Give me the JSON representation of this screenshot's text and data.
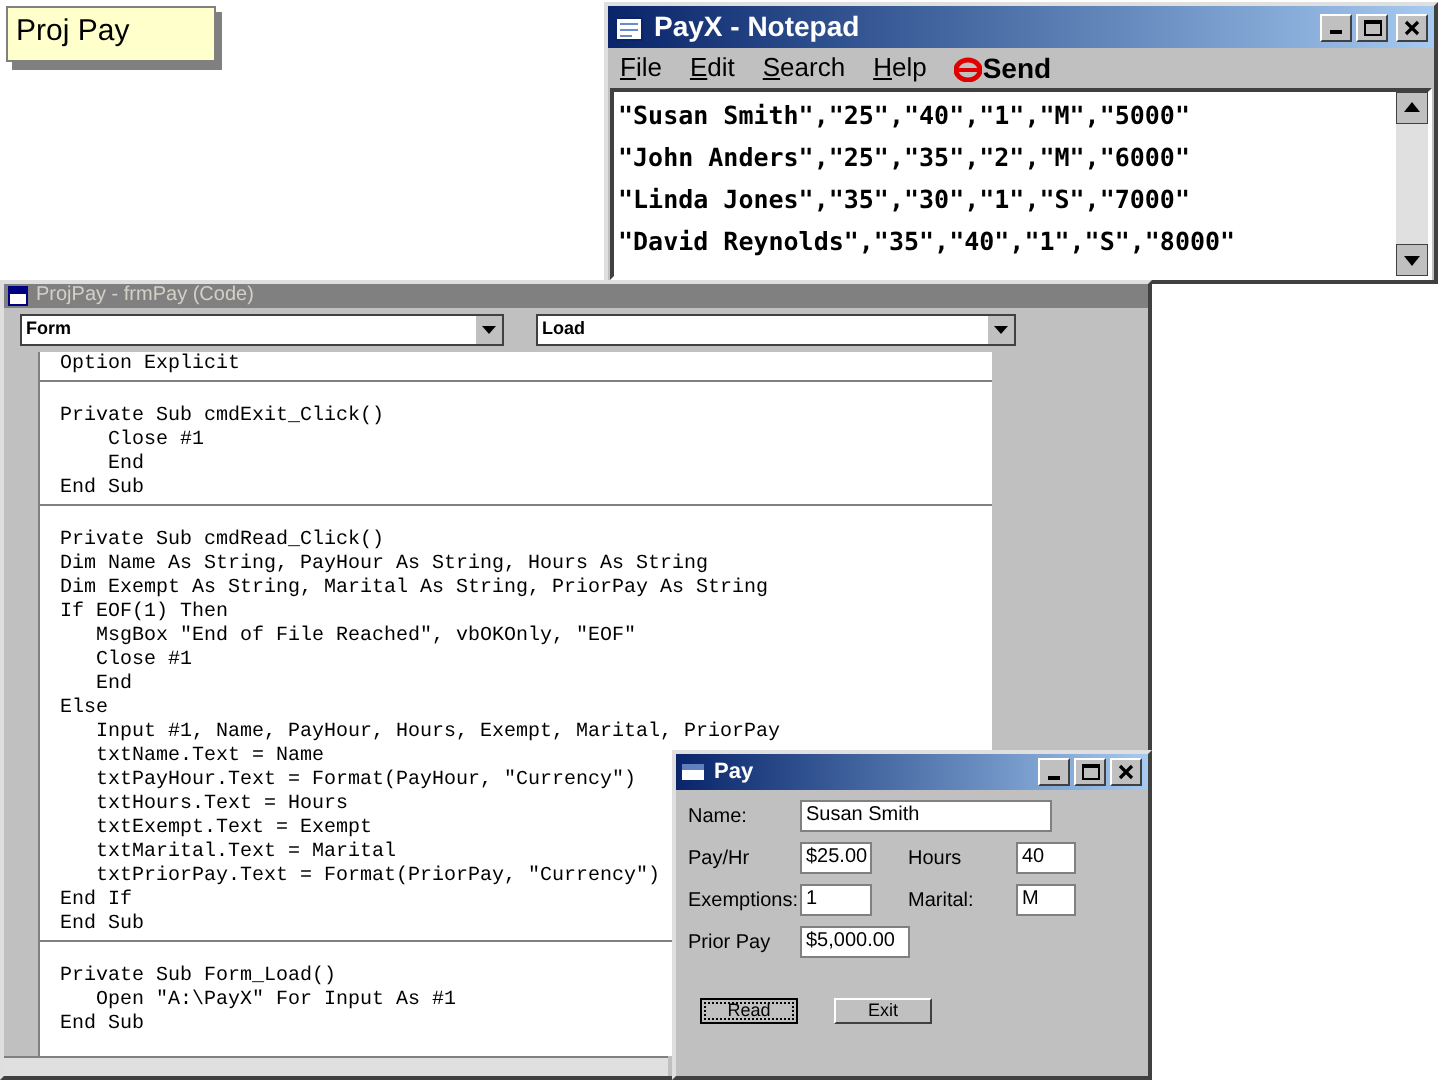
{
  "slide_label": "Proj Pay",
  "notepad": {
    "title": "PayX - Notepad",
    "menu": [
      {
        "label": "File"
      },
      {
        "label": "Edit"
      },
      {
        "label": "Search"
      },
      {
        "label": "Help"
      }
    ],
    "send": "Send",
    "lines": [
      "\"Susan Smith\",\"25\",\"40\",\"1\",\"M\",\"5000\"",
      "\"John Anders\",\"25\",\"35\",\"2\",\"M\",\"6000\"",
      "\"Linda Jones\",\"35\",\"30\",\"1\",\"S\",\"7000\"",
      "\"David Reynolds\",\"35\",\"40\",\"1\",\"S\",\"8000\""
    ]
  },
  "code_window": {
    "title": "ProjPay - frmPay (Code)",
    "object_combo": "Form",
    "procedure_combo": "Load",
    "procedures": [
      [
        "Option Explicit"
      ],
      [
        "Private Sub cmdExit_Click()",
        "    Close #1",
        "    End",
        "End Sub"
      ],
      [
        "Private Sub cmdRead_Click()",
        "Dim Name As String, PayHour As String, Hours As String",
        "Dim Exempt As String, Marital As String, PriorPay As String",
        "If EOF(1) Then",
        "   MsgBox \"End of File Reached\", vbOKOnly, \"EOF\"",
        "   Close #1",
        "   End",
        "Else",
        "   Input #1, Name, PayHour, Hours, Exempt, Marital, PriorPay",
        "   txtName.Text = Name",
        "   txtPayHour.Text = Format(PayHour, \"Currency\")",
        "   txtHours.Text = Hours",
        "   txtExempt.Text = Exempt",
        "   txtMarital.Text = Marital",
        "   txtPriorPay.Text = Format(PriorPay, \"Currency\")",
        "End If",
        "End Sub"
      ],
      [
        "Private Sub Form_Load()",
        "   Open \"A:\\PayX\" For Input As #1",
        "End Sub"
      ]
    ]
  },
  "pay_form": {
    "title": "Pay",
    "fields": [
      {
        "label": "Name:",
        "value": "Susan Smith",
        "kind": "wide"
      },
      {
        "label": "Pay/Hr",
        "value": "$25.00",
        "kind": "pair",
        "label2": "Hours",
        "value2": "40"
      },
      {
        "label": "Exemptions:",
        "value": "1",
        "kind": "pair",
        "label2": "Marital:",
        "value2": "M"
      },
      {
        "label": "Prior Pay",
        "value": "$5,000.00",
        "kind": "medium"
      }
    ],
    "buttons": [
      {
        "label": "Read",
        "focused": true
      },
      {
        "label": "Exit",
        "focused": false
      }
    ]
  }
}
